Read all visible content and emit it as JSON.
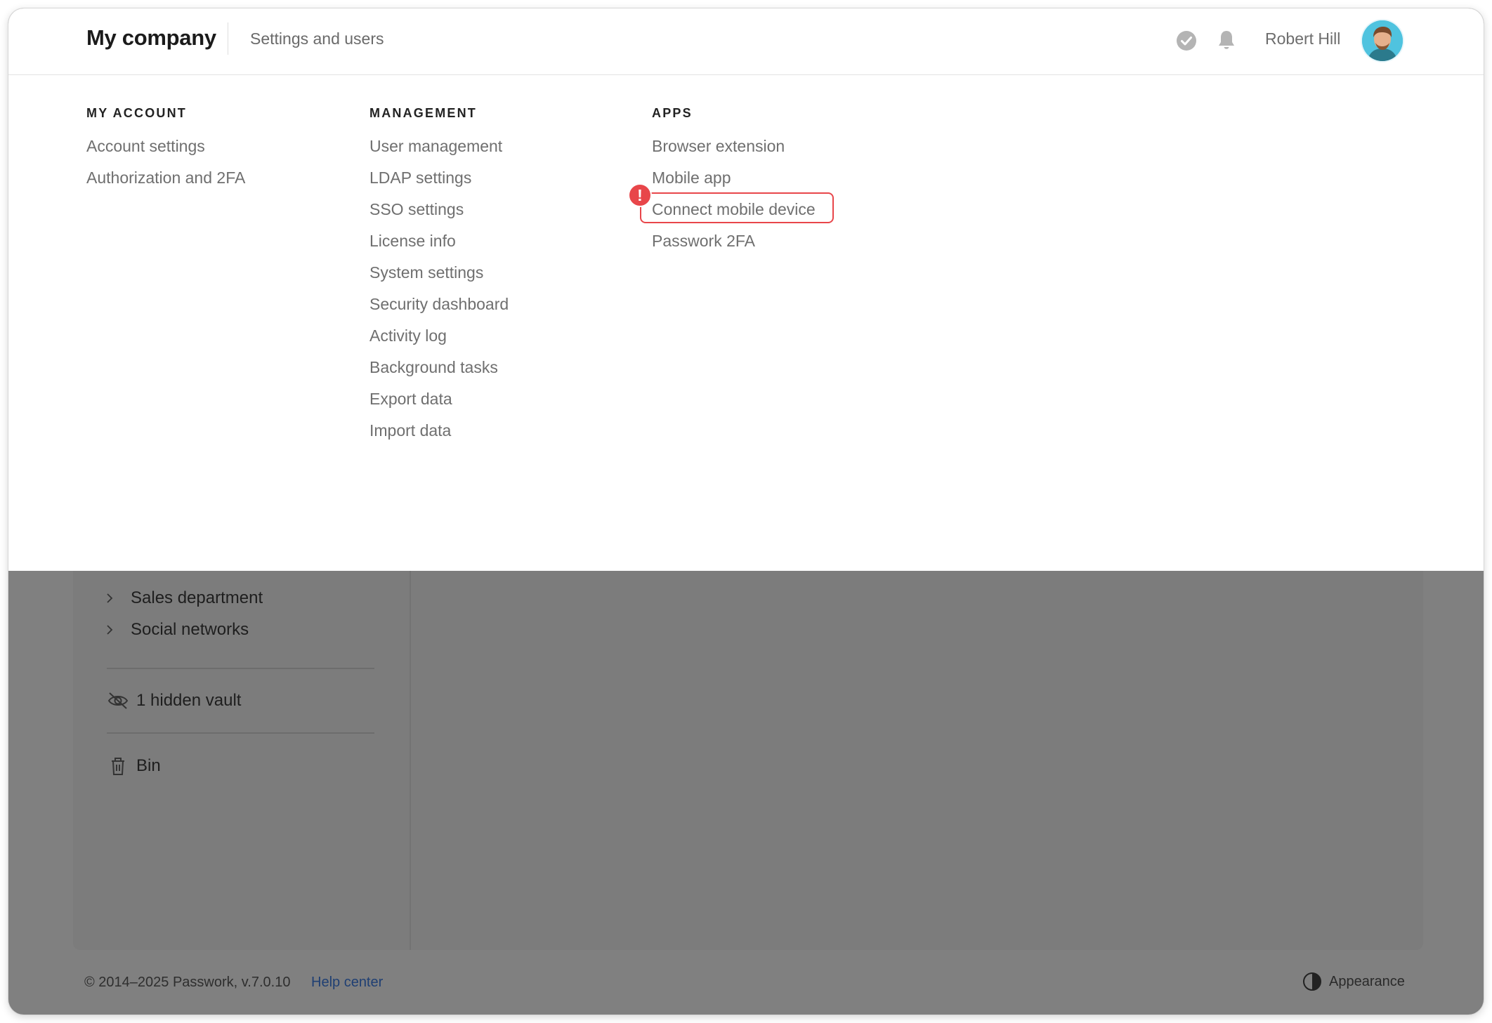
{
  "header": {
    "brand": "My company",
    "section": "Settings and users",
    "user_name": "Robert Hill"
  },
  "menu": {
    "my_account": {
      "title": "MY ACCOUNT",
      "items": [
        "Account settings",
        "Authorization and 2FA"
      ]
    },
    "management": {
      "title": "MANAGEMENT",
      "items": [
        "User management",
        "LDAP settings",
        "SSO settings",
        "License info",
        "System settings",
        "Security dashboard",
        "Activity log",
        "Background tasks",
        "Export data",
        "Import data"
      ]
    },
    "apps": {
      "title": "APPS",
      "items": [
        "Browser extension",
        "Mobile app",
        "Connect mobile device",
        "Passwork 2FA"
      ],
      "highlighted_index": 2,
      "alert_glyph": "!"
    }
  },
  "sidebar": {
    "vaults": [
      "Sales department",
      "Social networks"
    ],
    "hidden_vaults": "1 hidden vault",
    "bin": "Bin"
  },
  "footer": {
    "copyright": "© 2014–2025 Passwork, v.7.0.10",
    "help": "Help center",
    "appearance": "Appearance"
  },
  "colors": {
    "highlight": "#e8464a",
    "overlay": "#808080",
    "link": "#1f3f73"
  }
}
